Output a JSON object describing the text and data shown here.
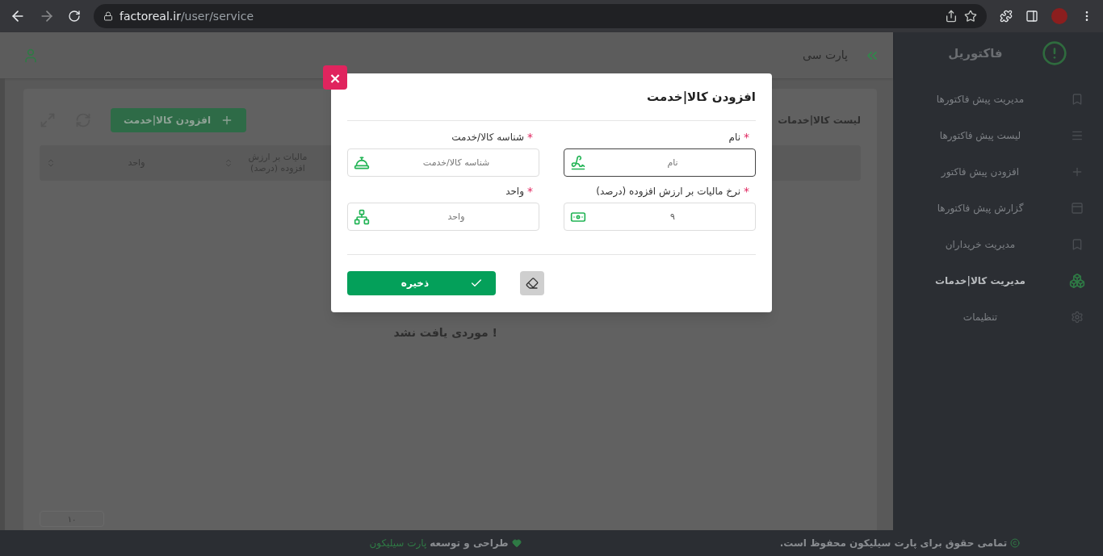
{
  "browser": {
    "url_host": "factoreal.ir",
    "url_path": "/user/service"
  },
  "sidebar": {
    "logo": "فاکتوریل",
    "items": [
      {
        "label": "مدیریت پیش فاکتورها",
        "kind": "bookmark",
        "selected": false
      },
      {
        "label": "لیست پیش فاکتورها",
        "kind": "list",
        "selected": false
      },
      {
        "label": "افزودن پیش فاکتور",
        "kind": "plus",
        "selected": false
      },
      {
        "label": "گزارش پیش فاکتورها",
        "kind": "window",
        "selected": false
      },
      {
        "label": "مدیریت خریداران",
        "kind": "bookmark",
        "selected": false
      },
      {
        "label": "مدیریت کالا|خدمات",
        "kind": "boxes",
        "selected": true
      },
      {
        "label": "تنظیمات",
        "kind": "gears",
        "selected": false
      }
    ]
  },
  "header": {
    "title": "پارت سی"
  },
  "page": {
    "title": "لیست کالا|خدمات",
    "add_button": "افزودن کالا|خدمت",
    "columns": [
      {
        "label": "مالیات بر ارزش افزوده (درصد)"
      },
      {
        "label": "واحد"
      }
    ],
    "empty_message": "! موردی یافت نشد",
    "page_size": "۱۰"
  },
  "modal": {
    "title": "افزودن کالا|خدمت",
    "close": "×",
    "fields": [
      {
        "label": "نام",
        "required_mark": "*",
        "placeholder": "نام",
        "kind": "signature",
        "focused": true
      },
      {
        "label": "شناسه کالا/خدمت",
        "required_mark": "*",
        "placeholder": "شناسه کالا/خدمت",
        "kind": "bell",
        "focused": false
      },
      {
        "label": "نرخ مالیات بر ارزش افزوده (درصد)",
        "required_mark": "*",
        "value": "۹",
        "kind": "money",
        "focused": false
      },
      {
        "label": "واحد",
        "required_mark": "*",
        "placeholder": "واحد",
        "kind": "tree",
        "focused": false
      }
    ],
    "save_button": "ذخیره"
  },
  "footer": {
    "copyright": "تمامی حقوق برای پارت سیلیکون محفوظ است.",
    "credit": "طراحی و توسعه",
    "credit_link": "پارت سیلیکون"
  }
}
